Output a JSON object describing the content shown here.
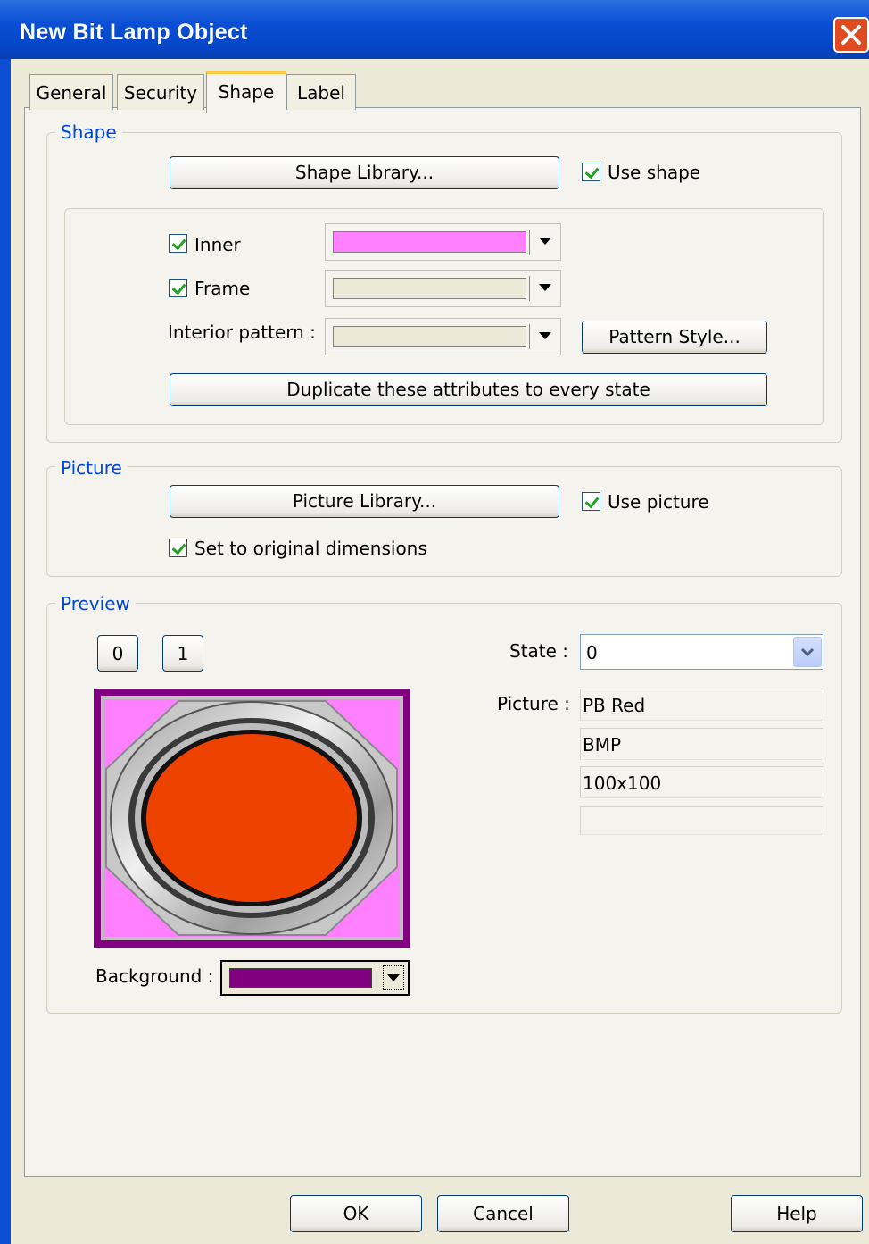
{
  "window": {
    "title": "New  Bit Lamp Object"
  },
  "tabs": [
    {
      "label": "General"
    },
    {
      "label": "Security"
    },
    {
      "label": "Shape"
    },
    {
      "label": "Label"
    }
  ],
  "shape_group": {
    "legend": "Shape",
    "library_button": "Shape Library...",
    "use_shape": {
      "label": "Use shape",
      "checked": true
    },
    "inner": {
      "label": "Inner",
      "checked": true,
      "color": "#ff80ff"
    },
    "frame": {
      "label": "Frame",
      "checked": true,
      "color": "#ece9d8"
    },
    "interior_pattern": {
      "label": "Interior pattern :",
      "color": "#ece9d8"
    },
    "pattern_style_button": "Pattern Style...",
    "duplicate_button": "Duplicate these attributes to every state"
  },
  "picture_group": {
    "legend": "Picture",
    "library_button": "Picture Library...",
    "use_picture": {
      "label": "Use picture",
      "checked": true
    },
    "original_dimensions": {
      "label": "Set to original dimensions",
      "checked": true
    }
  },
  "preview_group": {
    "legend": "Preview",
    "state_buttons": [
      "0",
      "1"
    ],
    "state_label": "State :",
    "state_value": "0",
    "picture_label": "Picture :",
    "picture_name": "PB Red",
    "picture_format": "BMP",
    "picture_size": "100x100",
    "picture_extra": "",
    "background_label": "Background :",
    "background_color": "#800080",
    "lamp_color": "#ee4200"
  },
  "footer": {
    "ok": "OK",
    "cancel": "Cancel",
    "help": "Help"
  }
}
